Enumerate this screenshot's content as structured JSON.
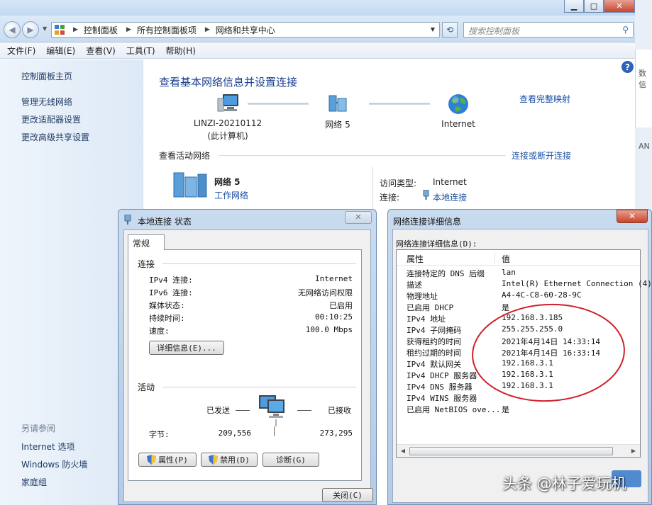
{
  "address_bar": {
    "breadcrumbs": [
      "控制面板",
      "所有控制面板项",
      "网络和共享中心"
    ],
    "search_placeholder": "搜索控制面板"
  },
  "menu": [
    "文件(F)",
    "编辑(E)",
    "查看(V)",
    "工具(T)",
    "帮助(H)"
  ],
  "sidebar": {
    "links": [
      "控制面板主页",
      "管理无线网络",
      "更改适配器设置",
      "更改高级共享设置"
    ],
    "see_also_title": "另请参阅",
    "see_also": [
      "Internet 选项",
      "Windows 防火墙",
      "家庭组"
    ]
  },
  "main": {
    "heading": "查看基本网络信息并设置连接",
    "view_full_map": "查看完整映射",
    "map": {
      "computer_name": "LINZI-20210112",
      "computer_sub": "(此计算机)",
      "network": "网络  5",
      "internet": "Internet"
    },
    "active_networks_title": "查看活动网络",
    "connect_disconnect": "连接或断开连接",
    "network_name": "网络  5",
    "network_type": "工作网络",
    "access_type_label": "访问类型:",
    "access_type_value": "Internet",
    "connection_label": "连接:",
    "connection_value": "本地连接"
  },
  "status_dialog": {
    "title": "本地连接 状态",
    "close": "✕",
    "tab": "常规",
    "connection_section": "连接",
    "rows": [
      {
        "label": "IPv4 连接:",
        "value": "Internet"
      },
      {
        "label": "IPv6 连接:",
        "value": "无网络访问权限"
      },
      {
        "label": "媒体状态:",
        "value": "已启用"
      },
      {
        "label": "持续时间:",
        "value": "00:10:25"
      },
      {
        "label": "速度:",
        "value": "100.0 Mbps"
      }
    ],
    "details_button": "详细信息(E)...",
    "activity_section": "活动",
    "sent_label": "已发送",
    "received_label": "已接收",
    "bytes_label": "字节:",
    "bytes_sent": "209,556",
    "bytes_received": "273,295",
    "properties_button": "属性(P)",
    "disable_button": "禁用(D)",
    "diagnose_button": "诊断(G)",
    "close_button": "关闭(C)"
  },
  "details_dialog": {
    "title": "网络连接详细信息",
    "close": "✕",
    "label": "网络连接详细信息(D):",
    "col_property": "属性",
    "col_value": "值",
    "rows": [
      {
        "prop": "连接特定的 DNS 后缀",
        "val": "lan"
      },
      {
        "prop": "描述",
        "val": "Intel(R) Ethernet Connection (4)"
      },
      {
        "prop": "物理地址",
        "val": "A4-4C-C8-60-28-9C"
      },
      {
        "prop": "已启用 DHCP",
        "val": "是"
      },
      {
        "prop": "IPv4 地址",
        "val": "192.168.3.185"
      },
      {
        "prop": "IPv4 子网掩码",
        "val": "255.255.255.0"
      },
      {
        "prop": "获得租约的时间",
        "val": "2021年4月14日 14:33:14"
      },
      {
        "prop": "租约过期的时间",
        "val": "2021年4月14日 16:33:14"
      },
      {
        "prop": "IPv4 默认网关",
        "val": "192.168.3.1"
      },
      {
        "prop": "IPv4 DHCP 服务器",
        "val": "192.168.3.1"
      },
      {
        "prop": "IPv4 DNS 服务器",
        "val": "192.168.3.1"
      },
      {
        "prop": "IPv4 WINS 服务器",
        "val": ""
      },
      {
        "prop": "已启用 NetBIOS ove...",
        "val": "是"
      }
    ]
  },
  "background_window_text": [
    "数信",
    "AN"
  ],
  "watermark": "头条 @林子爱玩机",
  "colors": {
    "link": "#1a4fa3",
    "heading": "#1c3f91",
    "annotation_ellipse": "#d0202a"
  }
}
